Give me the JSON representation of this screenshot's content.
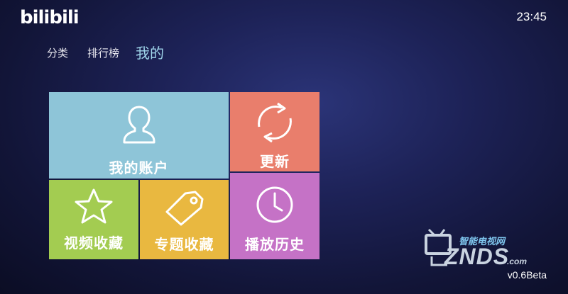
{
  "header": {
    "logo": "bilibili",
    "clock": "23:45"
  },
  "nav": {
    "items": [
      {
        "label": "分类"
      },
      {
        "label": "排行榜"
      },
      {
        "label": "我的",
        "active": true
      }
    ]
  },
  "tiles": {
    "account": {
      "label": "我的账户",
      "icon": "user-icon",
      "color": "#8ec5d8"
    },
    "update": {
      "label": "更新",
      "icon": "refresh-icon",
      "color": "#e97e6c"
    },
    "video_favorites": {
      "label": "视频收藏",
      "icon": "star-icon",
      "color": "#a3cc51"
    },
    "topic_favorites": {
      "label": "专题收藏",
      "icon": "tag-icon",
      "color": "#e9b840"
    },
    "history": {
      "label": "播放历史",
      "icon": "clock-icon",
      "color": "#c572c6"
    }
  },
  "watermark": {
    "site_name": "智能电视网",
    "brand": "ZNDS",
    "domain": ".com",
    "icon": "tv-icon"
  },
  "version": "v0.6Beta"
}
